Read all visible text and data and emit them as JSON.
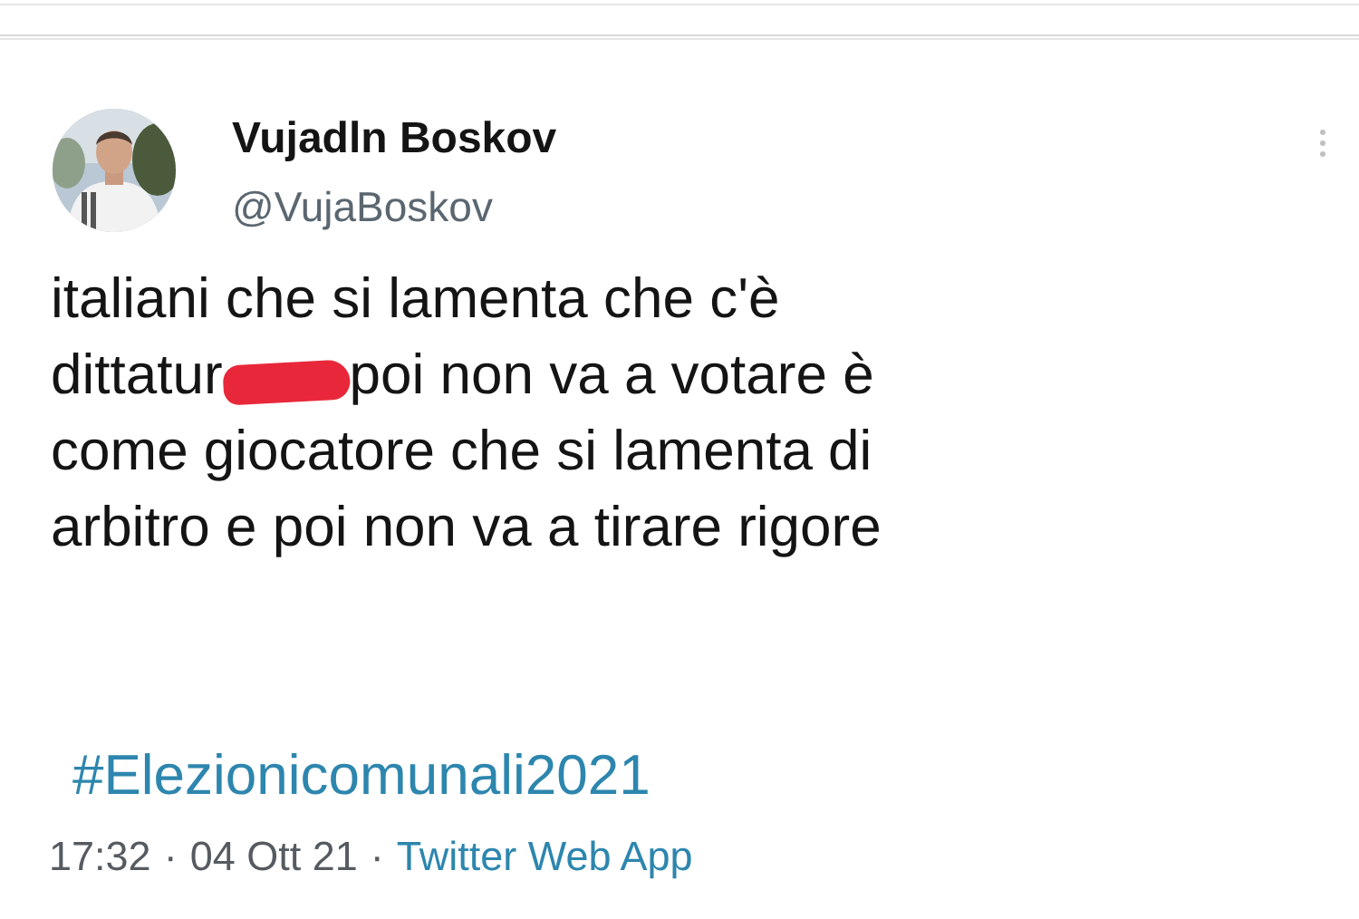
{
  "author": {
    "name": "Vujadln Boskov",
    "handle": "@VujaBoskov"
  },
  "body": [
    {
      "kind": "plain",
      "text": "italiani che si lamenta che c'è"
    },
    {
      "kind": "scribbled",
      "before": "dittatur",
      "after": "poi non va a votare è"
    },
    {
      "kind": "plain",
      "text": "come giocatore che si lamenta di"
    },
    {
      "kind": "plain",
      "text": "arbitro e poi non va a tirare rigore"
    }
  ],
  "hashtag": "#Elezionicomunali2021",
  "meta": {
    "time": "17:32",
    "separator_1": "·",
    "date": "04 Ott 21",
    "separator_2": "·",
    "source": "Twitter Web App"
  }
}
